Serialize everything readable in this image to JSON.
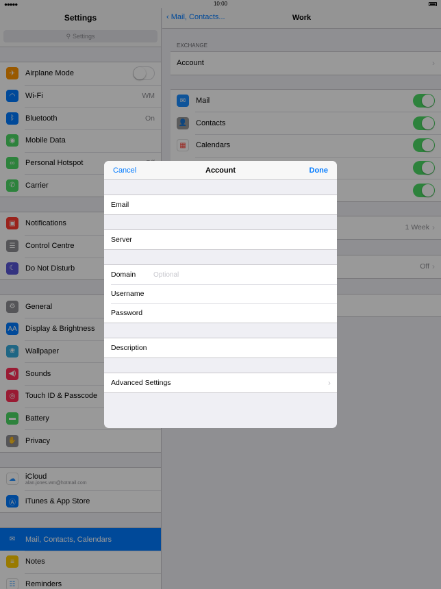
{
  "status": {
    "time": "10:00"
  },
  "master": {
    "title": "Settings",
    "search_placeholder": "Settings",
    "groups": [
      [
        {
          "label": "Airplane Mode",
          "icon": "airplane-icon",
          "color": "#ff9500",
          "glyph": "✈",
          "toggle": "off"
        },
        {
          "label": "Wi-Fi",
          "icon": "wifi-icon",
          "color": "#007aff",
          "glyph": "◠",
          "value": "WM"
        },
        {
          "label": "Bluetooth",
          "icon": "bluetooth-icon",
          "color": "#007aff",
          "glyph": "ᛒ",
          "value": "On"
        },
        {
          "label": "Mobile Data",
          "icon": "antenna-icon",
          "color": "#4cd964",
          "glyph": "◉"
        },
        {
          "label": "Personal Hotspot",
          "icon": "hotspot-icon",
          "color": "#4cd964",
          "glyph": "∞",
          "value": "Off"
        },
        {
          "label": "Carrier",
          "icon": "phone-icon",
          "color": "#4cd964",
          "glyph": "✆"
        }
      ],
      [
        {
          "label": "Notifications",
          "icon": "notifications-icon",
          "color": "#ff3b30",
          "glyph": "▣"
        },
        {
          "label": "Control Centre",
          "icon": "control-centre-icon",
          "color": "#8e8e93",
          "glyph": "☰"
        },
        {
          "label": "Do Not Disturb",
          "icon": "moon-icon",
          "color": "#5856d6",
          "glyph": "☾"
        }
      ],
      [
        {
          "label": "General",
          "icon": "gear-icon",
          "color": "#8e8e93",
          "glyph": "⚙"
        },
        {
          "label": "Display & Brightness",
          "icon": "display-icon",
          "color": "#007aff",
          "glyph": "AA"
        },
        {
          "label": "Wallpaper",
          "icon": "wallpaper-icon",
          "color": "#34aadc",
          "glyph": "❀"
        },
        {
          "label": "Sounds",
          "icon": "speaker-icon",
          "color": "#ff2d55",
          "glyph": "◀)"
        },
        {
          "label": "Touch ID & Passcode",
          "icon": "fingerprint-icon",
          "color": "#ff2d55",
          "glyph": "◎"
        },
        {
          "label": "Battery",
          "icon": "battery-icon",
          "color": "#4cd964",
          "glyph": "▬"
        },
        {
          "label": "Privacy",
          "icon": "hand-icon",
          "color": "#8e8e93",
          "glyph": "✋"
        }
      ],
      [
        {
          "label": "iCloud",
          "sub": "alan.jones.wm@hotmail.com",
          "icon": "cloud-icon",
          "color": "#ffffff",
          "glyph": "☁"
        },
        {
          "label": "iTunes & App Store",
          "icon": "app-store-icon",
          "color": "#007aff",
          "glyph": "Ⓐ"
        }
      ],
      [
        {
          "label": "Mail, Contacts, Calendars",
          "icon": "mail-icon",
          "color": "#007aff",
          "glyph": "✉",
          "selected": true
        },
        {
          "label": "Notes",
          "icon": "notes-icon",
          "color": "#ffcc00",
          "glyph": "≡"
        },
        {
          "label": "Reminders",
          "icon": "reminders-icon",
          "color": "#ffffff",
          "glyph": "☷"
        }
      ]
    ]
  },
  "detail": {
    "back_label": "Mail, Contacts...",
    "title": "Work",
    "section_header": "EXCHANGE",
    "account_label": "Account",
    "services": [
      {
        "label": "Mail",
        "icon": "mail-icon",
        "color": "#1a8cff",
        "glyph": "✉"
      },
      {
        "label": "Contacts",
        "icon": "contacts-icon",
        "color": "#9a9a9a",
        "glyph": "👤"
      },
      {
        "label": "Calendars",
        "icon": "calendar-icon",
        "color": "#ffffff",
        "glyph": "▦"
      },
      {
        "label": "",
        "icon": "",
        "color": "#ffffff",
        "glyph": ""
      },
      {
        "label": "",
        "icon": "",
        "color": "#ffffff",
        "glyph": ""
      }
    ],
    "mail_days_value": "1 Week",
    "off_value": "Off"
  },
  "modal": {
    "cancel": "Cancel",
    "title": "Account",
    "done": "Done",
    "email_label": "Email",
    "server_label": "Server",
    "domain_label": "Domain",
    "domain_placeholder": "Optional",
    "username_label": "Username",
    "password_label": "Password",
    "description_label": "Description",
    "advanced_label": "Advanced Settings"
  }
}
